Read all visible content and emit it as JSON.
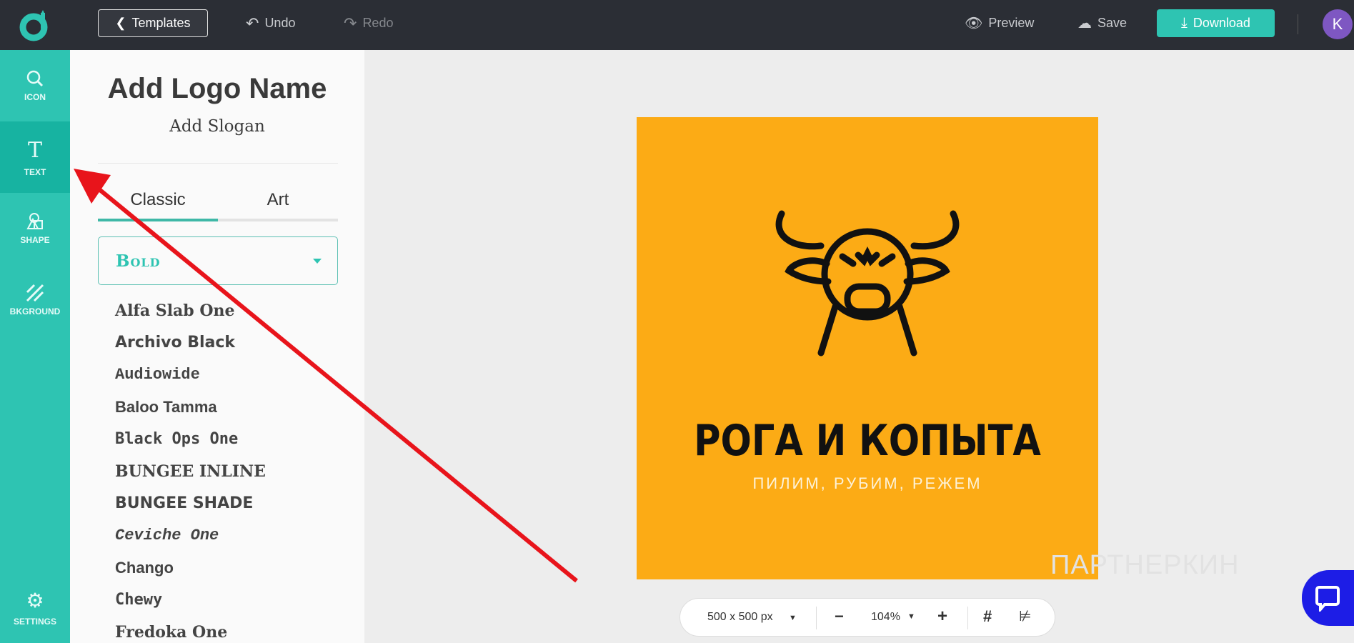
{
  "topbar": {
    "templates_label": "Templates",
    "undo_label": "Undo",
    "redo_label": "Redo",
    "preview_label": "Preview",
    "save_label": "Save",
    "download_label": "Download",
    "avatar_initial": "K"
  },
  "rail": {
    "items": [
      {
        "label": "ICON"
      },
      {
        "label": "TEXT"
      },
      {
        "label": "SHAPE"
      },
      {
        "label": "BKGROUND"
      }
    ],
    "settings_label": "SETTINGS",
    "active": "TEXT"
  },
  "panel": {
    "title": "Add Logo Name",
    "slogan": "Add Slogan",
    "tabs": [
      "Classic",
      "Art"
    ],
    "active_tab": "Classic",
    "category": "Bold",
    "fonts": [
      "Alfa Slab One",
      "Archivo Black",
      "Audiowide",
      "Baloo Tamma",
      "Black Ops One",
      "BUNGEE INLINE",
      "BUNGEE SHADE",
      "Ceviche One",
      "Chango",
      "Chewy",
      "Fredoka One"
    ]
  },
  "logo_canvas": {
    "name": "РОГА И КОПЫТА",
    "slogan": "ПИЛИМ, РУБИМ, РЕЖЕМ",
    "background": "#fcab15"
  },
  "zoombar": {
    "size": "500 x 500 px",
    "zoom": "104%",
    "minus": "−",
    "plus": "+"
  },
  "watermark": "ПАРТНЕРКИН",
  "colors": {
    "accent": "#2ec4b2",
    "topbar": "#2b2e35",
    "annotation_arrow": "#e8141b"
  }
}
